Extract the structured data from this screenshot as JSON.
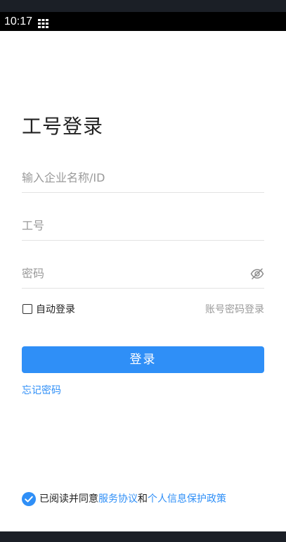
{
  "status_bar": {
    "time": "10:17",
    "icon": "grid-icon"
  },
  "login": {
    "title": "工号登录",
    "company_placeholder": "输入企业名称/ID",
    "employee_id_placeholder": "工号",
    "password_placeholder": "密码",
    "password_toggle_icon": "eye-off-icon",
    "auto_login_label": "自动登录",
    "auto_login_checked": false,
    "switch_mode_label": "账号密码登录",
    "submit_label": "登录",
    "forgot_password_label": "忘记密码"
  },
  "agreement": {
    "checked": true,
    "prefix": "已阅读并同意",
    "service_link": "服务协议",
    "conjunction": "和",
    "privacy_link": "个人信息保护政策"
  },
  "colors": {
    "accent": "#2f8ff7",
    "placeholder": "#9a9a9a",
    "divider": "#e3e3e3",
    "status_bar": "#000000"
  }
}
